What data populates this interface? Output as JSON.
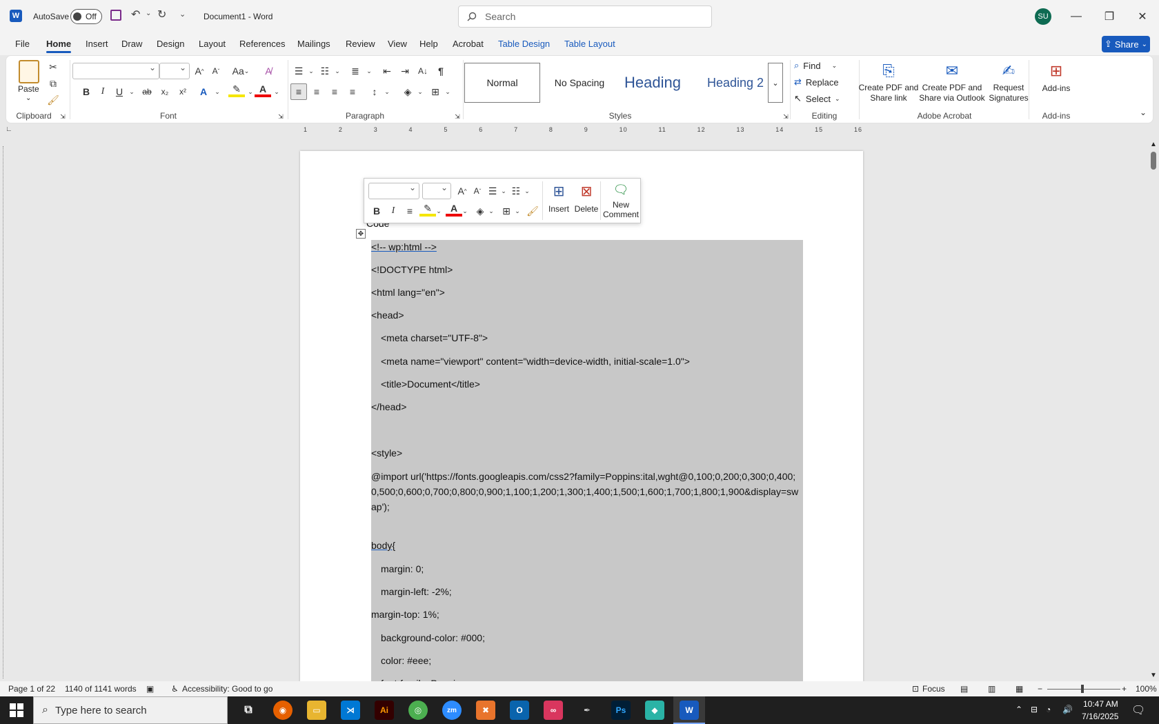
{
  "titlebar": {
    "autosave_label": "AutoSave",
    "autosave_state": "Off",
    "doc_title": "Document1  -  Word",
    "search_placeholder": "Search",
    "user_initials": "SU"
  },
  "tabs": [
    "File",
    "Home",
    "Insert",
    "Draw",
    "Design",
    "Layout",
    "References",
    "Mailings",
    "Review",
    "View",
    "Help",
    "Acrobat",
    "Table Design",
    "Table Layout"
  ],
  "active_tab": "Home",
  "share_label": "Share",
  "ribbon": {
    "clipboard": {
      "paste": "Paste",
      "group": "Clipboard"
    },
    "font": {
      "group": "Font",
      "aa": "Aa"
    },
    "paragraph": {
      "group": "Paragraph"
    },
    "styles": {
      "group": "Styles",
      "items": [
        "Normal",
        "No Spacing",
        "Heading",
        "Heading 2"
      ]
    },
    "editing": {
      "group": "Editing",
      "find": "Find",
      "replace": "Replace",
      "select": "Select"
    },
    "acrobat": {
      "group": "Adobe Acrobat",
      "btn1": "Create PDF and Share link",
      "btn2": "Create PDF and Share via Outlook",
      "btn3": "Request Signatures"
    },
    "addins": {
      "group": "Add-ins",
      "btn": "Add-ins"
    }
  },
  "ruler_numbers": [
    "1",
    "2",
    "3",
    "4",
    "5",
    "6",
    "7",
    "8",
    "9",
    "10",
    "11",
    "12",
    "13",
    "14",
    "15",
    "16"
  ],
  "minitoolbar": {
    "insert": "Insert",
    "delete": "Delete",
    "new_comment": "New Comment"
  },
  "document": {
    "caption": "Code",
    "lines": [
      "<!-- wp:html -->",
      "<!DOCTYPE html>",
      "<html lang=\"en\">",
      "<head>",
      "<meta charset=\"UTF-8\">",
      "<meta name=\"viewport\" content=\"width=device-width, initial-scale=1.0\">",
      "<title>Document</title>",
      "</head>",
      "<style>",
      "@import url('https://fonts.googleapis.com/css2?family=Poppins:ital,wght@0,100;0,200;0,300;0,400;0,500;0,600;0,700;0,800;0,900;1,100;1,200;1,300;1,400;1,500;1,600;1,700;1,800;1,900&display=swap');",
      "body{",
      "margin: 0;",
      "margin-left: -2%;",
      "margin-top: 1%;",
      "background-color: #000;",
      "color: #eee;",
      "font-family: Poppins;"
    ]
  },
  "status": {
    "page": "Page 1 of 22",
    "words": "1140 of 1141 words",
    "accessibility": "Accessibility: Good to go",
    "focus": "Focus",
    "zoom": "100%"
  },
  "taskbar": {
    "search_placeholder": "Type here to search",
    "time": "10:47 AM",
    "date": "7/16/2025"
  },
  "colors": {
    "accent": "#185abd",
    "avatar": "#0e6b52",
    "code_bg": "#c8c8c8"
  }
}
